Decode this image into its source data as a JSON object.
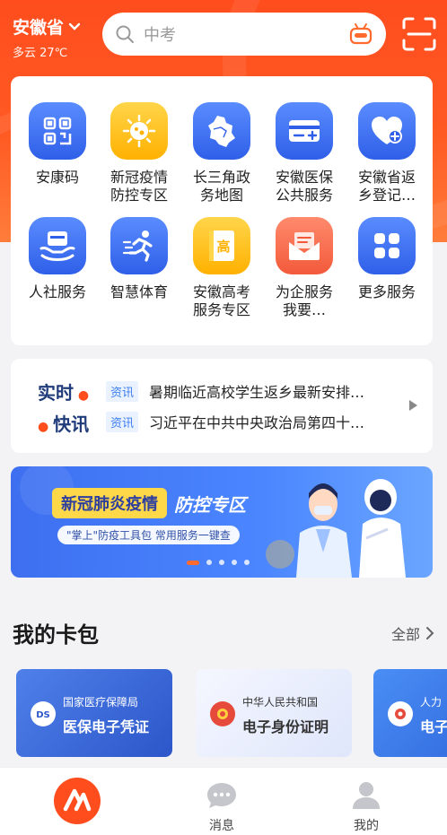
{
  "header": {
    "province": "安徽省",
    "weather": "多云 27℃",
    "search_placeholder": "中考"
  },
  "services": [
    {
      "label": "安康码",
      "icon": "qr-code-icon",
      "color": "blue"
    },
    {
      "label": "新冠疫情\n防控专区",
      "icon": "virus-icon",
      "color": "yellow"
    },
    {
      "label": "长三角政\n务地图",
      "icon": "map-icon",
      "color": "blue"
    },
    {
      "label": "安徽医保\n公共服务",
      "icon": "medical-card-icon",
      "color": "blue"
    },
    {
      "label": "安徽省返\n乡登记…",
      "icon": "heart-plus-icon",
      "color": "blue"
    },
    {
      "label": "人社服务",
      "icon": "social-security-icon",
      "color": "blue"
    },
    {
      "label": "智慧体育",
      "icon": "runner-icon",
      "color": "blue"
    },
    {
      "label": "安徽高考\n服务专区",
      "icon": "exam-book-icon",
      "color": "yellow"
    },
    {
      "label": "为企服务\n我要…",
      "icon": "envelope-icon",
      "color": "coral"
    },
    {
      "label": "更多服务",
      "icon": "grid-icon",
      "color": "blue"
    }
  ],
  "news": {
    "brand_line1": "实时",
    "brand_line2": "快讯",
    "items": [
      {
        "tag": "资讯",
        "text": "暑期临近高校学生返乡最新安排…"
      },
      {
        "tag": "资讯",
        "text": "习近平在中共中央政治局第四十…"
      }
    ]
  },
  "banner": {
    "title_highlight": "新冠肺炎疫情",
    "title_rest": "防控专区",
    "subtitle": "\"掌上\"防疫工具包 常用服务一键查",
    "slide_count": 5,
    "active_slide": 1
  },
  "wallet": {
    "title": "我的卡包",
    "all_label": "全部",
    "cards": [
      {
        "org": "国家医疗保障局",
        "name": "医保电子凭证"
      },
      {
        "org": "中华人民共和国",
        "name": "电子身份证明"
      },
      {
        "org": "人力",
        "name": "电子"
      }
    ]
  },
  "tabbar": {
    "home_label": "",
    "messages_label": "消息",
    "mine_label": "我的"
  },
  "colors": {
    "brand_orange": "#ff4d1e",
    "primary_blue": "#2f5fe8",
    "tag_blue": "#3c7ef0"
  }
}
